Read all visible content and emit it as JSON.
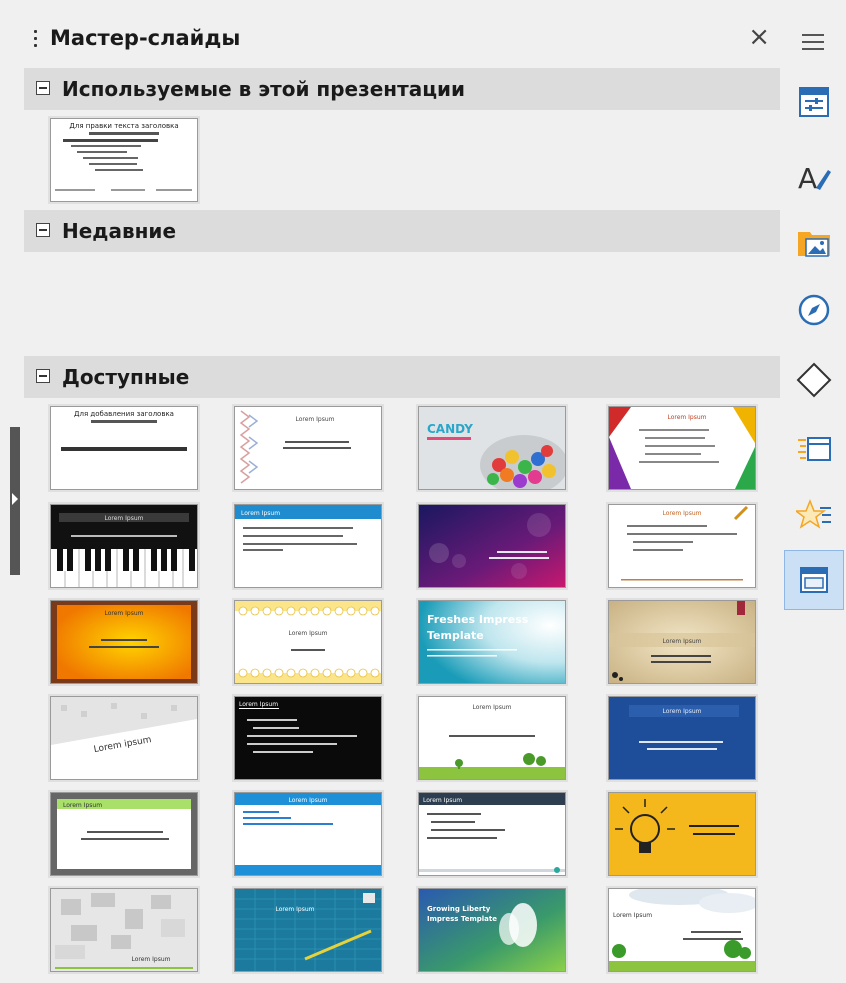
{
  "panel": {
    "title": "Мастер-слайды",
    "close_symbol": "×"
  },
  "sections": {
    "used": "Используемые в этой презентации",
    "recent": "Недавние",
    "available": "Доступные"
  },
  "thumb_texts": {
    "used_title": "Для правки текста заголовка",
    "avail_title": "Для добавления заголовка",
    "lorem": "Lorem Ipsum",
    "candy": "CANDY",
    "freshes_line1": "Freshes Impress",
    "freshes_line2": "Template",
    "lorem_lower": "Lorem ipsum",
    "growing_line1": "Growing Liberty",
    "growing_line2": "Impress Template"
  },
  "colors": {
    "section_bg": "#dcdcdc",
    "active_tab_bg": "#cce0f5",
    "accent_blue": "#1e73be"
  },
  "sidebar_icons": [
    "menu-icon",
    "properties-icon",
    "styles-icon",
    "gallery-icon",
    "navigator-icon",
    "shapes-icon",
    "slide-transition-icon",
    "animation-icon",
    "master-slides-icon"
  ]
}
